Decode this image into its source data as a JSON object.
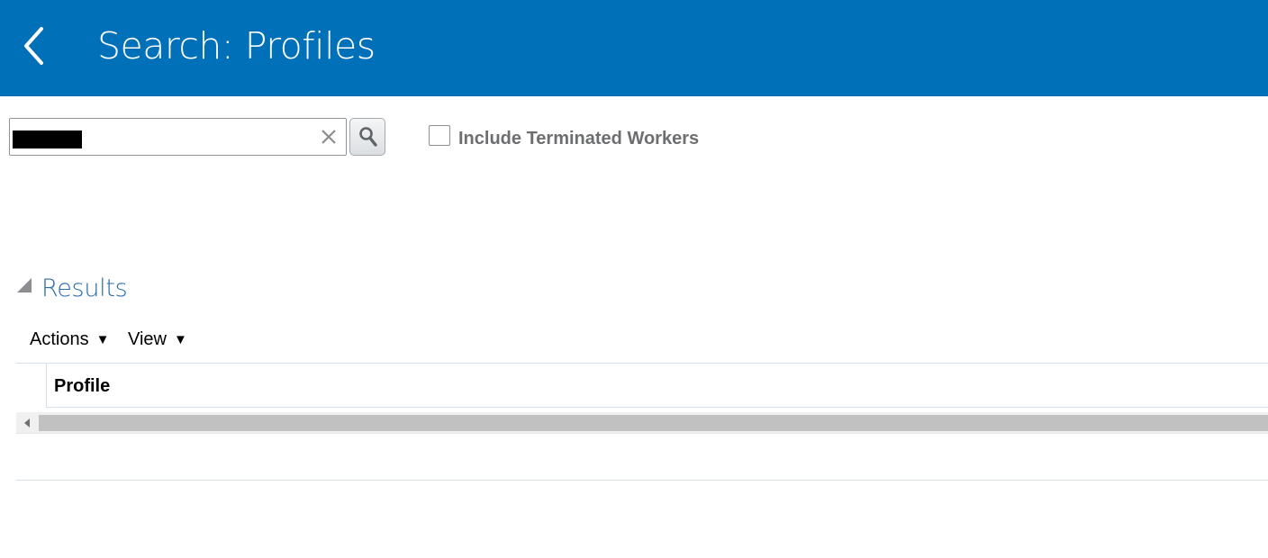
{
  "header": {
    "title": "Search: Profiles",
    "back_icon": "chevron-left-icon",
    "background": "#0070b9"
  },
  "search": {
    "value": "██████",
    "value_redacted": true,
    "clear_icon": "close-icon",
    "search_icon": "search-icon"
  },
  "filters": {
    "include_terminated_label": "Include Terminated Workers",
    "include_terminated_checked": false
  },
  "results": {
    "title": "Results",
    "collapse_icon": "triangle-expanded-icon",
    "toolbar": {
      "actions_label": "Actions",
      "view_label": "View",
      "caret": "▼"
    },
    "table": {
      "columns": [
        "Profile"
      ],
      "rows": []
    }
  },
  "colors": {
    "brand_blue": "#0070b9",
    "results_title": "#2b6cab",
    "label_gray": "#6d6e70"
  }
}
